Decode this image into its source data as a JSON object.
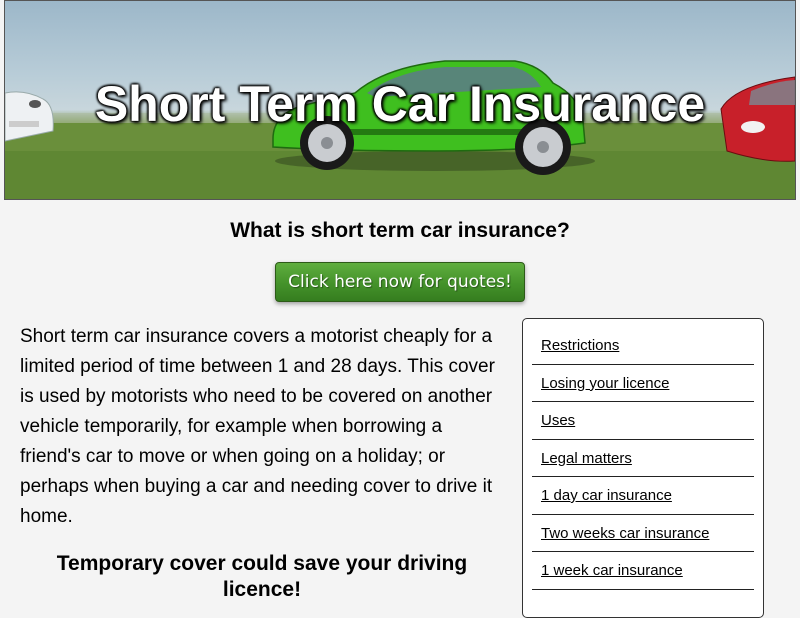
{
  "banner": {
    "title": "Short Term Car Insurance",
    "image": "cars-on-grass-banner"
  },
  "main": {
    "question": "What is short term car insurance?",
    "cta_label": "Click here now for quotes!",
    "intro": "Short term car insurance covers a motorist cheaply for a limited period of time between 1 and 28 days. This cover is used by motorists who need to be covered on another vehicle temporarily, for example when borrowing a friend's car to move or when going on a holiday; or perhaps when buying a car and needing cover to drive it home.",
    "subheading": "Temporary cover could save your driving licence!"
  },
  "sidebar": {
    "items": [
      {
        "label": "Restrictions"
      },
      {
        "label": "Losing your licence"
      },
      {
        "label": "Uses"
      },
      {
        "label": "Legal matters"
      },
      {
        "label": "1 day car insurance"
      },
      {
        "label": "Two weeks car insurance"
      },
      {
        "label": "1 week car insurance"
      }
    ]
  },
  "colors": {
    "cta_green": "#44922a",
    "page_background": "#f4f4f4",
    "car_green": "#3fbf1f",
    "car_red": "#c8202a"
  }
}
